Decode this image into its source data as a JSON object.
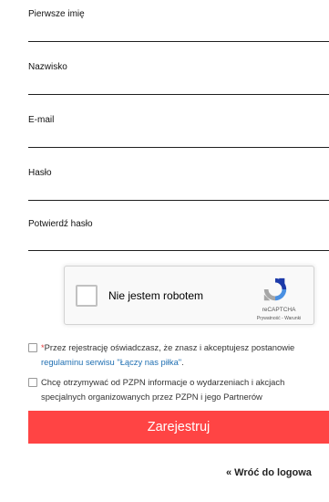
{
  "form": {
    "fields": [
      {
        "label": "Pierwsze imię"
      },
      {
        "label": "Nazwisko"
      },
      {
        "label": "E-mail"
      },
      {
        "label": "Hasło"
      },
      {
        "label": "Potwierdź hasło"
      }
    ],
    "recaptcha": {
      "label": "Nie jestem robotem",
      "brand": "reCAPTCHA",
      "links": "Prywatność - Warunki"
    },
    "terms": {
      "required_mark": "*",
      "text_line1": "Przez rejestrację oświadczasz, że znasz i akceptujesz postanowie",
      "link_text": "regulaminu serwisu \"Łączy nas piłka\"",
      "suffix": "."
    },
    "marketing": {
      "text_line1": "Chcę otrzymywać od PZPN informacje o wydarzeniach i akcjach",
      "text_line2": "specjalnych organizowanych przez PZPN i jego Partnerów"
    },
    "register_label": "Zarejestruj",
    "back_label": "« Wróć do logowa"
  },
  "colors": {
    "accent": "#ff4444",
    "link": "#1f6fb2",
    "required": "#e53a3a"
  }
}
